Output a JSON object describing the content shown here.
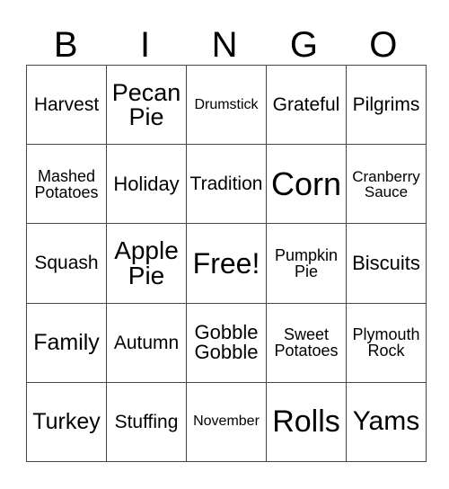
{
  "header": [
    "B",
    "I",
    "N",
    "G",
    "O"
  ],
  "cells": [
    [
      {
        "text": "Harvest",
        "size": 21
      },
      {
        "text": "Pecan Pie",
        "size": 27
      },
      {
        "text": "Drumstick",
        "size": 16
      },
      {
        "text": "Grateful",
        "size": 21
      },
      {
        "text": "Pilgrims",
        "size": 21
      }
    ],
    [
      {
        "text": "Mashed Potatoes",
        "size": 18
      },
      {
        "text": "Holiday",
        "size": 22
      },
      {
        "text": "Tradition",
        "size": 21
      },
      {
        "text": "Corn",
        "size": 36
      },
      {
        "text": "Cranberry Sauce",
        "size": 17
      }
    ],
    [
      {
        "text": "Squash",
        "size": 21
      },
      {
        "text": "Apple Pie",
        "size": 28
      },
      {
        "text": "Free!",
        "size": 32
      },
      {
        "text": "Pumpkin Pie",
        "size": 18
      },
      {
        "text": "Biscuits",
        "size": 22
      }
    ],
    [
      {
        "text": "Family",
        "size": 25
      },
      {
        "text": "Autumn",
        "size": 21
      },
      {
        "text": "Gobble Gobble",
        "size": 22
      },
      {
        "text": "Sweet Potatoes",
        "size": 18
      },
      {
        "text": "Plymouth Rock",
        "size": 18
      }
    ],
    [
      {
        "text": "Turkey",
        "size": 25
      },
      {
        "text": "Stuffing",
        "size": 21
      },
      {
        "text": "November",
        "size": 16
      },
      {
        "text": "Rolls",
        "size": 34
      },
      {
        "text": "Yams",
        "size": 30
      }
    ]
  ]
}
